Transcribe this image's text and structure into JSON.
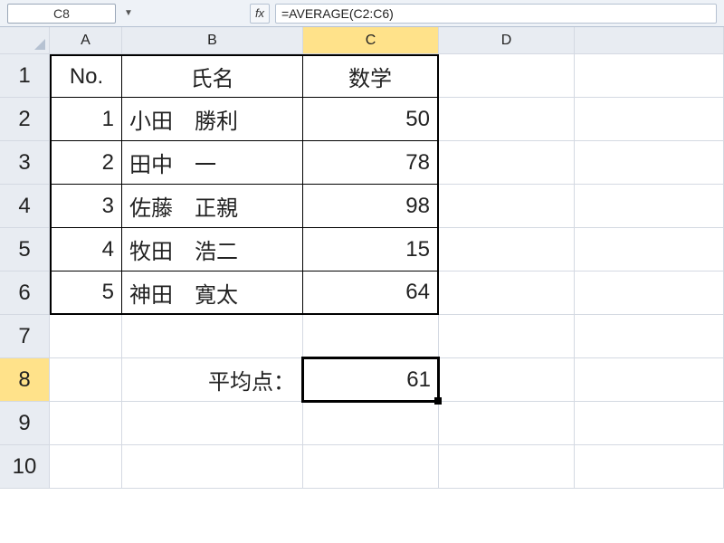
{
  "formula_bar": {
    "name_box": "C8",
    "fx_label": "fx",
    "formula": "=AVERAGE(C2:C6)"
  },
  "columns": [
    "A",
    "B",
    "C",
    "D"
  ],
  "rows": [
    "1",
    "2",
    "3",
    "4",
    "5",
    "6",
    "7",
    "8",
    "9",
    "10"
  ],
  "header": {
    "no": "No.",
    "name": "氏名",
    "math": "数学"
  },
  "students": [
    {
      "no": "1",
      "name": "小田　勝利",
      "score": "50"
    },
    {
      "no": "2",
      "name": "田中　一",
      "score": "78"
    },
    {
      "no": "3",
      "name": "佐藤　正親",
      "score": "98"
    },
    {
      "no": "4",
      "name": "牧田　浩二",
      "score": "15"
    },
    {
      "no": "5",
      "name": "神田　寛太",
      "score": "64"
    }
  ],
  "summary": {
    "label": "平均点：",
    "value": "61"
  },
  "active": {
    "col": "C",
    "row": "8"
  },
  "chart_data": {
    "type": "table",
    "title": "数学",
    "categories": [
      "小田　勝利",
      "田中　一",
      "佐藤　正親",
      "牧田　浩二",
      "神田　寛太"
    ],
    "values": [
      50,
      78,
      98,
      15,
      64
    ],
    "average": 61
  }
}
